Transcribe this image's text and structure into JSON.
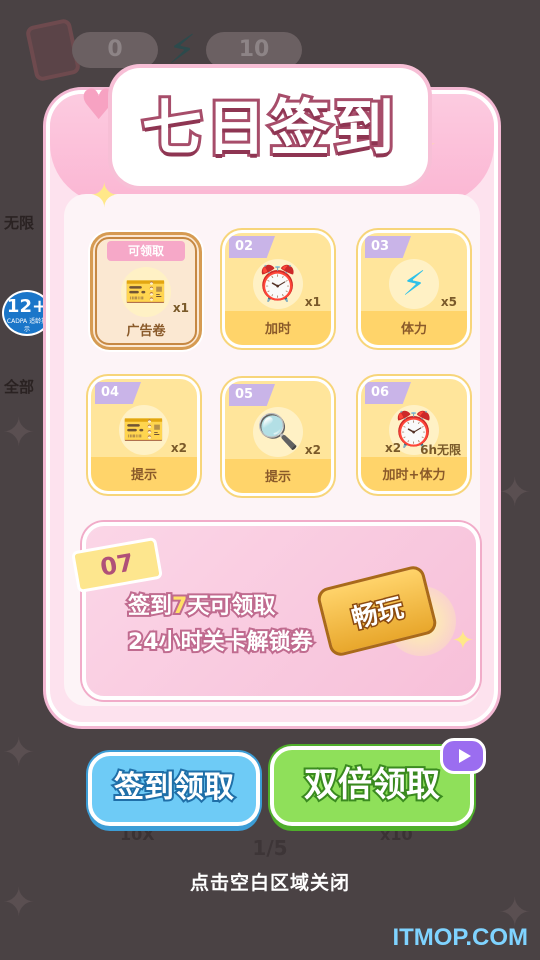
{
  "background": {
    "ticket_count": "0",
    "energy_count": "10",
    "side_label_top": "无限",
    "side_label_mid": "全部",
    "age_rating": "12+",
    "age_sub": "CADPA 适龄提示",
    "rewind_label": "10X",
    "page_indicator": "1/5",
    "forward_label": "x10"
  },
  "title": "七日签到",
  "rewards": [
    {
      "day": "",
      "tag": "可领取",
      "name": "广告卷",
      "count": "x1",
      "icon": "ticket-icon"
    },
    {
      "day": "02",
      "name": "加时",
      "count": "x1",
      "icon": "alarm-clock-icon"
    },
    {
      "day": "03",
      "name": "体力",
      "count": "x5",
      "icon": "lightning-icon"
    },
    {
      "day": "04",
      "name": "提示",
      "count": "x2",
      "icon": "ticket-icon"
    },
    {
      "day": "05",
      "name": "提示",
      "count": "x2",
      "icon": "magnifier-icon"
    },
    {
      "day": "06",
      "name": "加时+体力",
      "count": "x2",
      "count2": "6h无限",
      "icon": "clock-bolt-icon"
    }
  ],
  "day7": {
    "badge": "07",
    "line1_a": "签到",
    "line1_num": "7",
    "line1_b": "天可领取",
    "line2": "24小时关卡解锁券",
    "pass_label": "畅玩"
  },
  "buttons": {
    "claim": "签到领取",
    "double_claim": "双倍领取"
  },
  "close_hint": "点击空白区域关闭",
  "watermark": "ITMOP.COM"
}
